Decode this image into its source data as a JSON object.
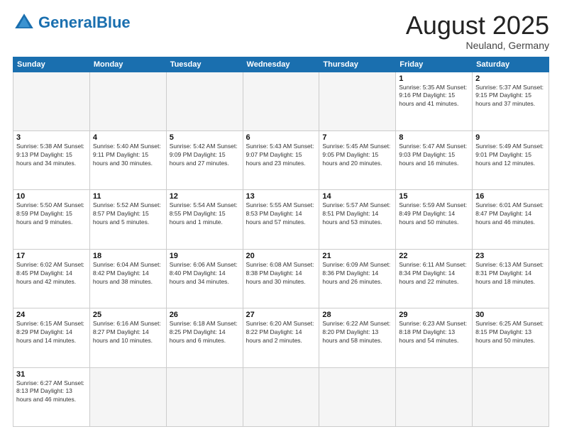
{
  "header": {
    "logo_general": "General",
    "logo_blue": "Blue",
    "month_title": "August 2025",
    "subtitle": "Neuland, Germany"
  },
  "days_of_week": [
    "Sunday",
    "Monday",
    "Tuesday",
    "Wednesday",
    "Thursday",
    "Friday",
    "Saturday"
  ],
  "weeks": [
    [
      {
        "day": "",
        "info": ""
      },
      {
        "day": "",
        "info": ""
      },
      {
        "day": "",
        "info": ""
      },
      {
        "day": "",
        "info": ""
      },
      {
        "day": "",
        "info": ""
      },
      {
        "day": "1",
        "info": "Sunrise: 5:35 AM\nSunset: 9:16 PM\nDaylight: 15 hours\nand 41 minutes."
      },
      {
        "day": "2",
        "info": "Sunrise: 5:37 AM\nSunset: 9:15 PM\nDaylight: 15 hours\nand 37 minutes."
      }
    ],
    [
      {
        "day": "3",
        "info": "Sunrise: 5:38 AM\nSunset: 9:13 PM\nDaylight: 15 hours\nand 34 minutes."
      },
      {
        "day": "4",
        "info": "Sunrise: 5:40 AM\nSunset: 9:11 PM\nDaylight: 15 hours\nand 30 minutes."
      },
      {
        "day": "5",
        "info": "Sunrise: 5:42 AM\nSunset: 9:09 PM\nDaylight: 15 hours\nand 27 minutes."
      },
      {
        "day": "6",
        "info": "Sunrise: 5:43 AM\nSunset: 9:07 PM\nDaylight: 15 hours\nand 23 minutes."
      },
      {
        "day": "7",
        "info": "Sunrise: 5:45 AM\nSunset: 9:05 PM\nDaylight: 15 hours\nand 20 minutes."
      },
      {
        "day": "8",
        "info": "Sunrise: 5:47 AM\nSunset: 9:03 PM\nDaylight: 15 hours\nand 16 minutes."
      },
      {
        "day": "9",
        "info": "Sunrise: 5:49 AM\nSunset: 9:01 PM\nDaylight: 15 hours\nand 12 minutes."
      }
    ],
    [
      {
        "day": "10",
        "info": "Sunrise: 5:50 AM\nSunset: 8:59 PM\nDaylight: 15 hours\nand 9 minutes."
      },
      {
        "day": "11",
        "info": "Sunrise: 5:52 AM\nSunset: 8:57 PM\nDaylight: 15 hours\nand 5 minutes."
      },
      {
        "day": "12",
        "info": "Sunrise: 5:54 AM\nSunset: 8:55 PM\nDaylight: 15 hours\nand 1 minute."
      },
      {
        "day": "13",
        "info": "Sunrise: 5:55 AM\nSunset: 8:53 PM\nDaylight: 14 hours\nand 57 minutes."
      },
      {
        "day": "14",
        "info": "Sunrise: 5:57 AM\nSunset: 8:51 PM\nDaylight: 14 hours\nand 53 minutes."
      },
      {
        "day": "15",
        "info": "Sunrise: 5:59 AM\nSunset: 8:49 PM\nDaylight: 14 hours\nand 50 minutes."
      },
      {
        "day": "16",
        "info": "Sunrise: 6:01 AM\nSunset: 8:47 PM\nDaylight: 14 hours\nand 46 minutes."
      }
    ],
    [
      {
        "day": "17",
        "info": "Sunrise: 6:02 AM\nSunset: 8:45 PM\nDaylight: 14 hours\nand 42 minutes."
      },
      {
        "day": "18",
        "info": "Sunrise: 6:04 AM\nSunset: 8:42 PM\nDaylight: 14 hours\nand 38 minutes."
      },
      {
        "day": "19",
        "info": "Sunrise: 6:06 AM\nSunset: 8:40 PM\nDaylight: 14 hours\nand 34 minutes."
      },
      {
        "day": "20",
        "info": "Sunrise: 6:08 AM\nSunset: 8:38 PM\nDaylight: 14 hours\nand 30 minutes."
      },
      {
        "day": "21",
        "info": "Sunrise: 6:09 AM\nSunset: 8:36 PM\nDaylight: 14 hours\nand 26 minutes."
      },
      {
        "day": "22",
        "info": "Sunrise: 6:11 AM\nSunset: 8:34 PM\nDaylight: 14 hours\nand 22 minutes."
      },
      {
        "day": "23",
        "info": "Sunrise: 6:13 AM\nSunset: 8:31 PM\nDaylight: 14 hours\nand 18 minutes."
      }
    ],
    [
      {
        "day": "24",
        "info": "Sunrise: 6:15 AM\nSunset: 8:29 PM\nDaylight: 14 hours\nand 14 minutes."
      },
      {
        "day": "25",
        "info": "Sunrise: 6:16 AM\nSunset: 8:27 PM\nDaylight: 14 hours\nand 10 minutes."
      },
      {
        "day": "26",
        "info": "Sunrise: 6:18 AM\nSunset: 8:25 PM\nDaylight: 14 hours\nand 6 minutes."
      },
      {
        "day": "27",
        "info": "Sunrise: 6:20 AM\nSunset: 8:22 PM\nDaylight: 14 hours\nand 2 minutes."
      },
      {
        "day": "28",
        "info": "Sunrise: 6:22 AM\nSunset: 8:20 PM\nDaylight: 13 hours\nand 58 minutes."
      },
      {
        "day": "29",
        "info": "Sunrise: 6:23 AM\nSunset: 8:18 PM\nDaylight: 13 hours\nand 54 minutes."
      },
      {
        "day": "30",
        "info": "Sunrise: 6:25 AM\nSunset: 8:15 PM\nDaylight: 13 hours\nand 50 minutes."
      }
    ],
    [
      {
        "day": "31",
        "info": "Sunrise: 6:27 AM\nSunset: 8:13 PM\nDaylight: 13 hours\nand 46 minutes."
      },
      {
        "day": "",
        "info": ""
      },
      {
        "day": "",
        "info": ""
      },
      {
        "day": "",
        "info": ""
      },
      {
        "day": "",
        "info": ""
      },
      {
        "day": "",
        "info": ""
      },
      {
        "day": "",
        "info": ""
      }
    ]
  ]
}
